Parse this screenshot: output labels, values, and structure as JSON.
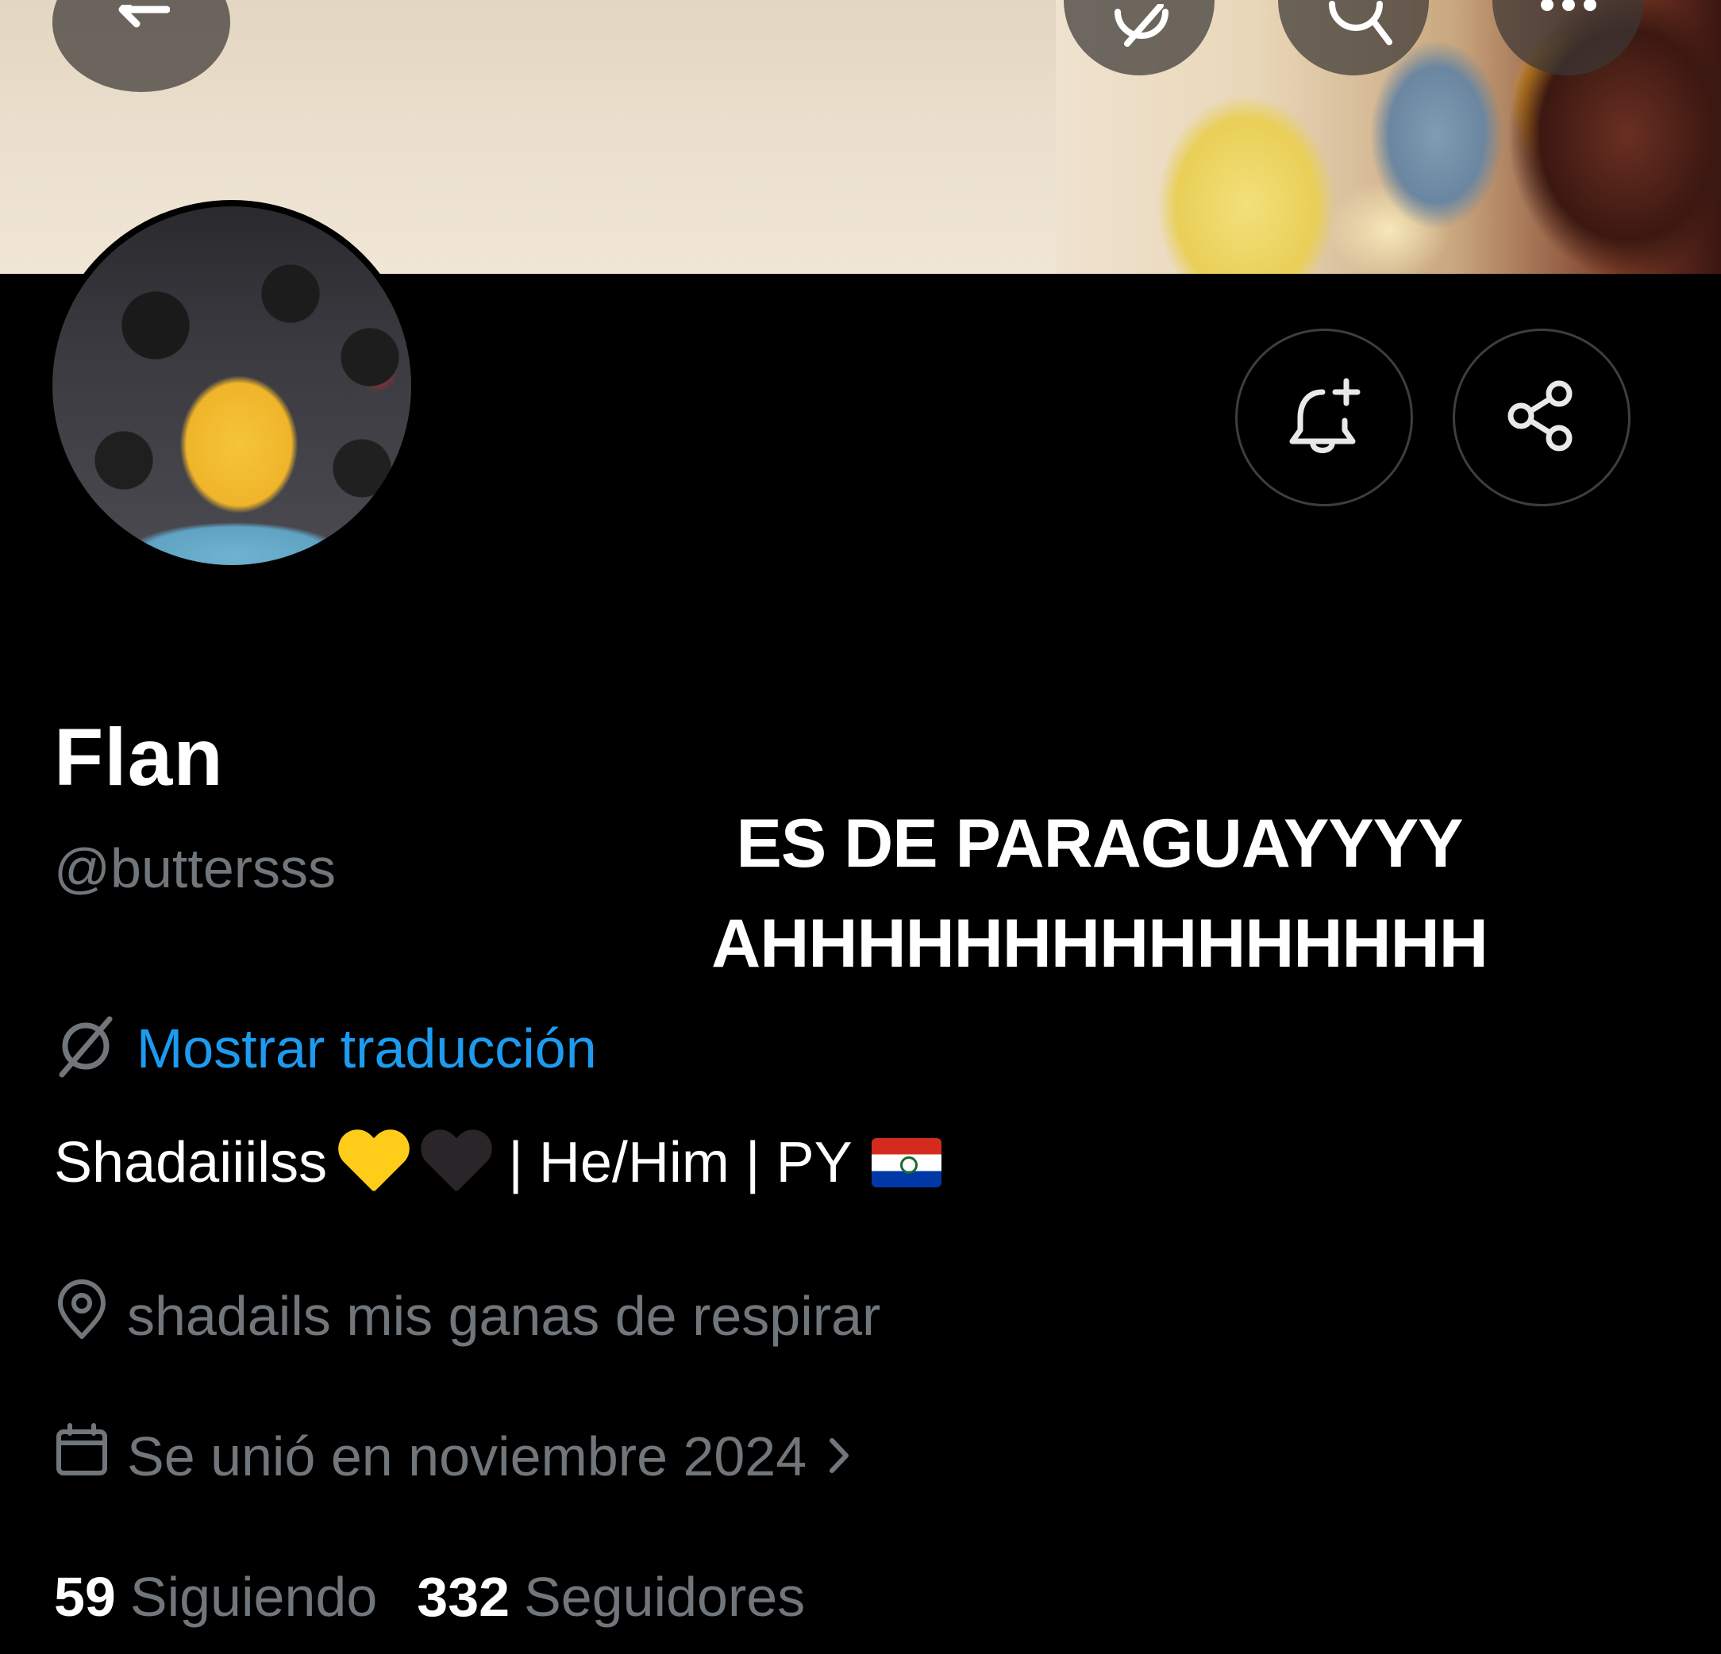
{
  "profile": {
    "name": "Flan",
    "handle": "@buttersss",
    "bio_prefix": "Shadaiiilss",
    "bio_suffix": "| He/Him | PY",
    "location": "shadails mis ganas de respirar",
    "joined": "Se unió en noviembre 2024",
    "following_count": "59",
    "following_label": "Siguiendo",
    "followers_count": "332",
    "followers_label": "Seguidores"
  },
  "translate": {
    "label": "Mostrar traducción"
  },
  "overlay": {
    "line1": "ES DE PARAGUAYYYY",
    "line2": "AHHHHHHHHHHHHHHH"
  },
  "icons": {
    "back": "arrow-left-icon",
    "top_right": [
      "circle-slash-icon",
      "search-icon",
      "more-icon"
    ],
    "notify": "bell-plus-icon",
    "share": "share-icon",
    "translate": "translate-icon",
    "location": "location-pin-icon",
    "calendar": "calendar-icon",
    "emoji": [
      "yellow-heart-icon",
      "black-heart-icon",
      "paraguay-flag-icon"
    ]
  },
  "colors": {
    "background": "#000000",
    "link": "#1d9bf0",
    "muted": "#71767b",
    "text": "#e7e9ea"
  }
}
